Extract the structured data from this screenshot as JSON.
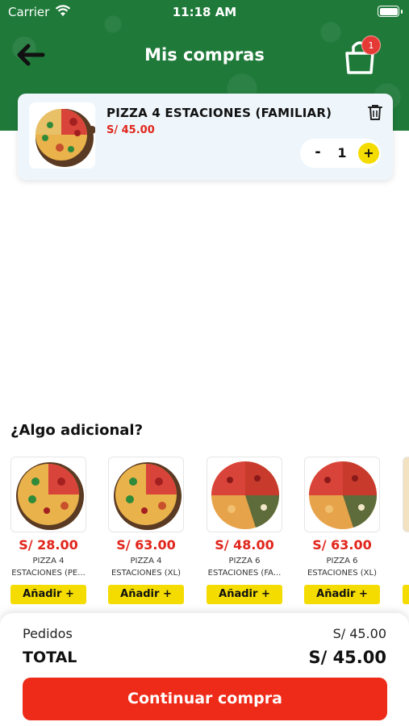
{
  "status_bar": {
    "carrier": "Carrier",
    "time": "11:18 AM"
  },
  "header": {
    "title": "Mis compras",
    "back_icon": "arrow-left-icon",
    "cart_icon": "shopping-bag-icon",
    "cart_badge": "1"
  },
  "cart": {
    "items": [
      {
        "name": "PIZZA 4 ESTACIONES (FAMILIAR)",
        "price": "S/ 45.00",
        "quantity": "1",
        "minus_label": "-",
        "plus_label": "+",
        "delete_icon": "trash-icon"
      }
    ]
  },
  "extras": {
    "title": "¿Algo adicional?",
    "items": [
      {
        "price": "S/ 28.00",
        "name": "PIZZA 4 ESTACIONES (PE...",
        "button": "Añadir +"
      },
      {
        "price": "S/ 63.00",
        "name": "PIZZA 4 ESTACIONES (XL)",
        "button": "Añadir +"
      },
      {
        "price": "S/ 48.00",
        "name": "PIZZA 6 ESTACIONES (FA...",
        "button": "Añadir +"
      },
      {
        "price": "S/ 63.00",
        "name": "PIZZA 6 ESTACIONES (XL)",
        "button": "Añadir +"
      }
    ]
  },
  "summary": {
    "orders_label": "Pedidos",
    "orders_value": "S/ 45.00",
    "total_label": "TOTAL",
    "total_value": "S/ 45.00",
    "continue_label": "Continuar compra"
  },
  "colors": {
    "header_green": "#1f7a3a",
    "accent_red": "#ee2a18",
    "accent_yellow": "#f5dc00"
  }
}
